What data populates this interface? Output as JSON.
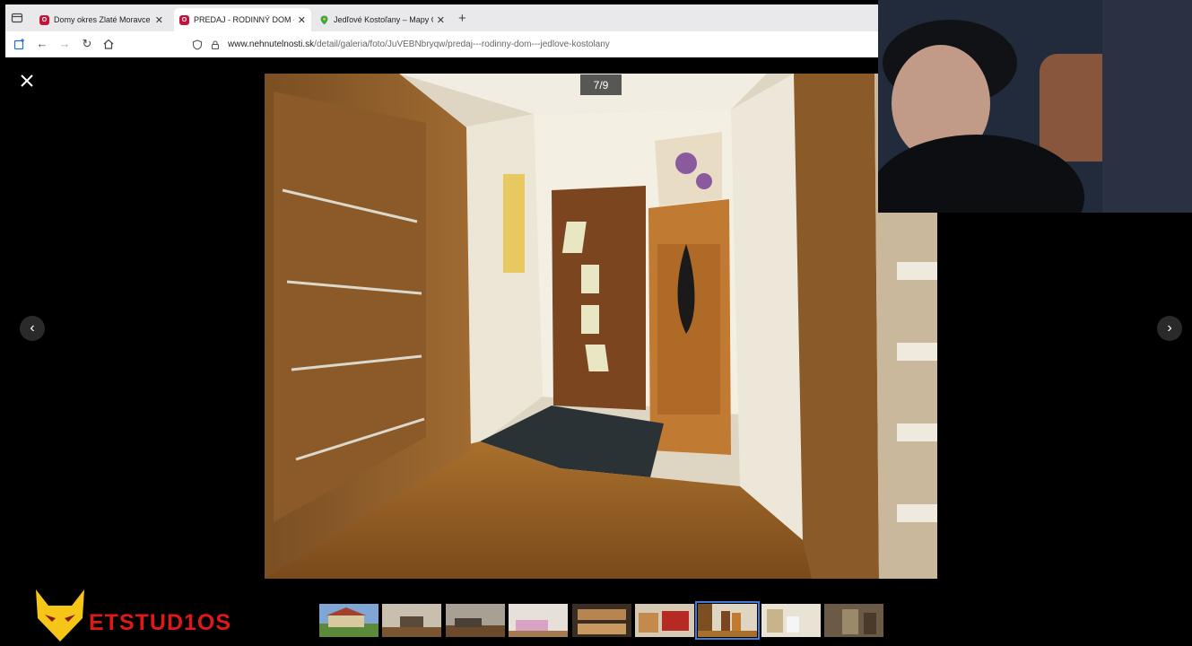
{
  "browser": {
    "tabs": [
      {
        "label": "Domy okres Zlaté Moravce - po",
        "favicon": "nehnutelnosti-favicon",
        "favicon_color": "#c0163c",
        "active": false
      },
      {
        "label": "PREDAJ - RODINNÝ DOM - JED",
        "favicon": "nehnutelnosti-favicon",
        "favicon_color": "#c0163c",
        "active": true
      },
      {
        "label": "Jedľové Kostoľany – Mapy Goo",
        "favicon": "google-maps-favicon",
        "favicon_color": "#34a853",
        "active": false
      }
    ],
    "url_host": "www.nehnutelnosti.sk",
    "url_path": "/detail/galeria/foto/JuVEBNbryqw/predaj---rodinny-dom---jedlove-kostolany"
  },
  "gallery": {
    "counter": "7/9",
    "current_index": 7,
    "total": 9,
    "thumbnails": [
      {
        "name": "house-exterior"
      },
      {
        "name": "living-room"
      },
      {
        "name": "bedroom"
      },
      {
        "name": "kids-room"
      },
      {
        "name": "kitchen"
      },
      {
        "name": "kitchen-red"
      },
      {
        "name": "hallway",
        "active": true
      },
      {
        "name": "bathroom"
      },
      {
        "name": "boiler-room"
      }
    ]
  },
  "overlay": {
    "logo_text": "ETSTUD1OS",
    "logo_color": "#e01818"
  },
  "colors": {
    "accent": "#3d7bd6",
    "background": "#000000"
  }
}
